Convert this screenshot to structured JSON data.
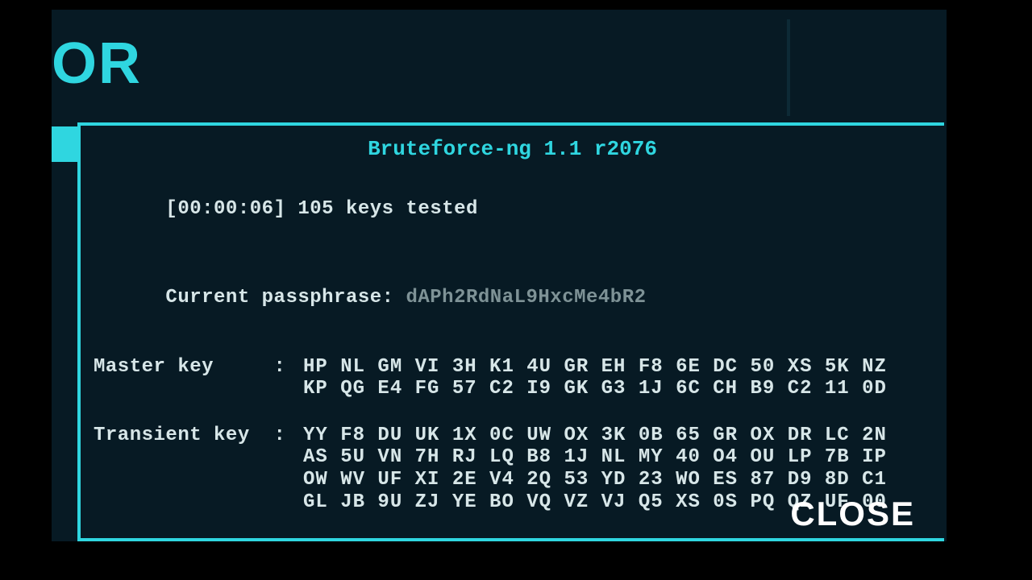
{
  "logo_fragment": "OR",
  "panel": {
    "title": "Bruteforce-ng 1.1 r2076",
    "elapsed": "[00:00:06]",
    "keys_tested": "105 keys tested",
    "passphrase_label": "Current passphrase: ",
    "passphrase_value": "dAPh2RdNaL9HxcMe4bR2",
    "master_key_label": "Master key     : ",
    "master_key_rows": [
      "HP NL GM VI 3H K1 4U GR EH F8 6E DC 50 XS 5K NZ",
      "KP QG E4 FG 57 C2 I9 GK G3 1J 6C CH B9 C2 11 0D"
    ],
    "transient_key_label": "Transient key  : ",
    "transient_key_rows": [
      "YY F8 DU UK 1X 0C UW OX 3K 0B 65 GR OX DR LC 2N",
      "AS 5U VN 7H RJ LQ B8 1J NL MY 40 O4 OU LP 7B IP",
      "OW WV UF XI 2E V4 2Q 53 YD 23 WO ES 87 D9 8D C1",
      "GL JB 9U ZJ YE BO VQ VZ VJ Q5 XS 0S PQ QZ UF 00"
    ],
    "close_label": "CLOSE"
  }
}
